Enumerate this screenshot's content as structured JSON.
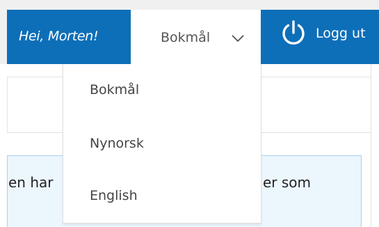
{
  "header": {
    "greeting": "Hei, Morten!",
    "language_selected": "Bokmål",
    "logout_label": "Logg ut"
  },
  "language_menu": {
    "options": [
      "Bokmål",
      "Nynorsk",
      "English"
    ]
  },
  "content": {
    "fragment_left": "en har",
    "fragment_right": "er som"
  },
  "colors": {
    "accent": "#0d6fb8",
    "info_bg": "#ecf6fd"
  }
}
